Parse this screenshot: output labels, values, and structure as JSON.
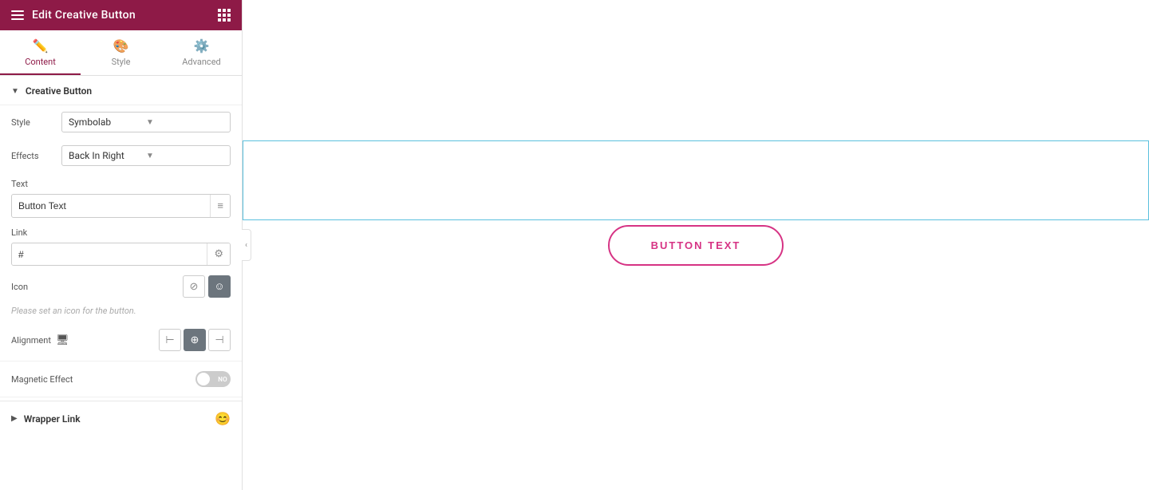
{
  "header": {
    "title": "Edit Creative Button",
    "hamburger_label": "menu",
    "grid_label": "apps"
  },
  "tabs": [
    {
      "id": "content",
      "label": "Content",
      "icon": "✏️",
      "active": true
    },
    {
      "id": "style",
      "label": "Style",
      "icon": "🎨",
      "active": false
    },
    {
      "id": "advanced",
      "label": "Advanced",
      "icon": "⚙️",
      "active": false
    }
  ],
  "sections": {
    "creative_button": {
      "title": "Creative Button",
      "style_label": "Style",
      "style_value": "Symbolab",
      "effects_label": "Effects",
      "effects_value": "Back In Right",
      "text_label": "Text",
      "text_value": "Button Text",
      "text_placeholder": "Button Text",
      "link_label": "Link",
      "link_value": "#",
      "icon_label": "Icon",
      "icon_hint": "Please set an icon for the button.",
      "alignment_label": "Alignment",
      "magnetic_effect_label": "Magnetic Effect",
      "magnetic_value": "NO"
    },
    "wrapper_link": {
      "title": "Wrapper Link"
    }
  },
  "preview": {
    "button_text": "BUTTON TEXT"
  }
}
